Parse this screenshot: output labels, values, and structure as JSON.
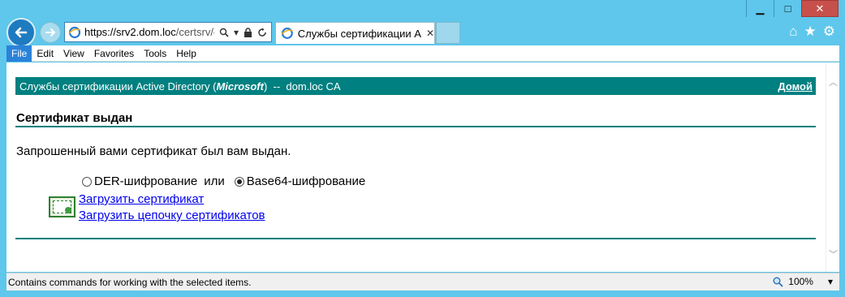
{
  "window": {
    "minimize": "▁",
    "maximize": "□",
    "close": "✕"
  },
  "nav": {
    "address_host": "https://srv2.dom.loc",
    "address_path": "/certsrv/c",
    "search_icon": "search-icon",
    "lock_icon": "lock-icon"
  },
  "tab": {
    "label": "Службы сертификации Ac...",
    "close": "✕"
  },
  "menu": {
    "items": [
      "File",
      "Edit",
      "View",
      "Favorites",
      "Tools",
      "Help"
    ],
    "active_index": 0
  },
  "banner": {
    "prefix": "Службы сертификации Active Directory (",
    "brand": "Microsoft",
    "suffix": ")  --  dom.loc CA",
    "home_link": "Домой",
    "color": "#008080"
  },
  "page": {
    "title": "Сертификат выдан",
    "message": "Запрошенный вами сертификат был вам выдан.",
    "der_label": "DER-шифрование",
    "or_label": "или",
    "base64_label": "Base64-шифрование",
    "selected_encoding": "Base64-шифрование",
    "download_cert": "Загрузить сертификат",
    "download_chain": "Загрузить цепочку сертификатов"
  },
  "status": {
    "text": "Contains commands for working with the selected items.",
    "zoom": "100%"
  },
  "colors": {
    "frame": "#5ec7eb",
    "link": "#0000ee",
    "menu_active": "#2b82d9"
  }
}
